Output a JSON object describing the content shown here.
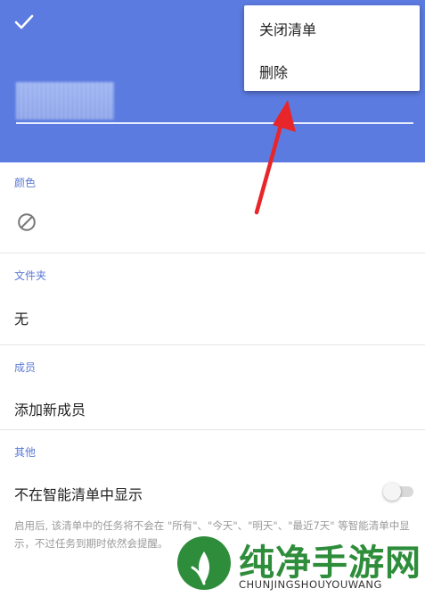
{
  "header": {
    "confirm_icon": "check-icon",
    "title_blurred": true,
    "background_color": "#5b7be0"
  },
  "menu": {
    "items": [
      {
        "label": "关闭清单"
      },
      {
        "label": "删除"
      }
    ]
  },
  "sections": {
    "color": {
      "label": "颜色",
      "icon": "no-color-icon"
    },
    "folder": {
      "label": "文件夹",
      "value": "无"
    },
    "members": {
      "label": "成员",
      "action": "添加新成员"
    },
    "other": {
      "label": "其他",
      "option": "不在智能清单中显示",
      "toggle_on": false,
      "description": "启用后, 该清单中的任务将不会在 \"所有\"、\"今天\"、\"明天\"、\"最近7天\" 等智能清单中显示，不过任务到期时依然会提醒。"
    }
  },
  "annotation": {
    "arrow_color": "#e8262a"
  },
  "watermark": {
    "title": "纯净手游网",
    "subtitle": "CHUNJINGSHOUYOUWANG"
  },
  "colors": {
    "accent": "#5a78d8"
  }
}
